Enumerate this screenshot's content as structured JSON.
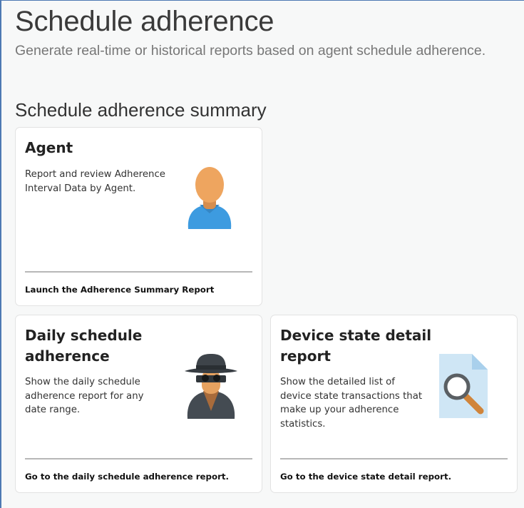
{
  "header": {
    "title": "Schedule adherence",
    "subtitle": "Generate real-time or historical reports based on agent schedule adherence."
  },
  "section": {
    "title": "Schedule adherence summary"
  },
  "cards": {
    "agent": {
      "title": "Agent",
      "description": "Report and review Adherence Interval Data by Agent.",
      "link": "Launch the Adherence Summary Report",
      "icon": "agent-person-icon"
    },
    "daily": {
      "title": "Daily schedule adherence",
      "description": "Show the daily schedule adherence report for any date range.",
      "link": "Go to the daily schedule adherence report.",
      "icon": "spy-detective-icon"
    },
    "device": {
      "title": "Device state detail report",
      "description": "Show the detailed list of device state transactions that make up your adherence statistics.",
      "link": "Go to the device state detail report.",
      "icon": "document-search-icon"
    }
  },
  "colors": {
    "frame": "#4d79b3",
    "person_head": "#eea55f",
    "person_body": "#3d9be0",
    "spy_dark": "#444b52",
    "document": "#cfe6f5",
    "magnifier_handle": "#d0843a"
  }
}
